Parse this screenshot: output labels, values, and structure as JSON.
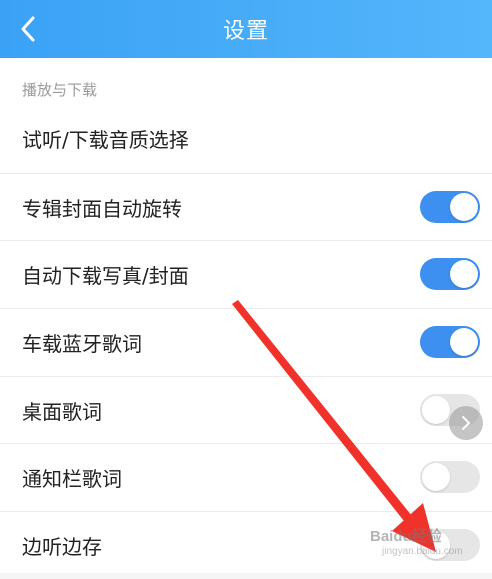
{
  "header": {
    "title": "设置",
    "back_icon": "chevron-left-icon",
    "gradient": [
      "#3aa2f5",
      "#54b6fb"
    ]
  },
  "section": {
    "title": "播放与下载"
  },
  "rows": [
    {
      "label": "试听/下载音质选择",
      "toggle": null
    },
    {
      "label": "专辑封面自动旋转",
      "toggle": "on"
    },
    {
      "label": "自动下载写真/封面",
      "toggle": "on"
    },
    {
      "label": "车载蓝牙歌词",
      "toggle": "on"
    },
    {
      "label": "桌面歌词",
      "toggle": "off"
    },
    {
      "label": "通知栏歌词",
      "toggle": "off"
    },
    {
      "label": "边听边存",
      "toggle": "off"
    }
  ],
  "colors": {
    "toggle_on": "#3d8ff0",
    "toggle_off": "#e6e6e6",
    "annotation_arrow": "#f0322a"
  },
  "overlay": {
    "float_button_icon": "chevron-right-icon",
    "watermark": "Baidu经验",
    "watermark_sub": "jingyan.baidu.com"
  }
}
